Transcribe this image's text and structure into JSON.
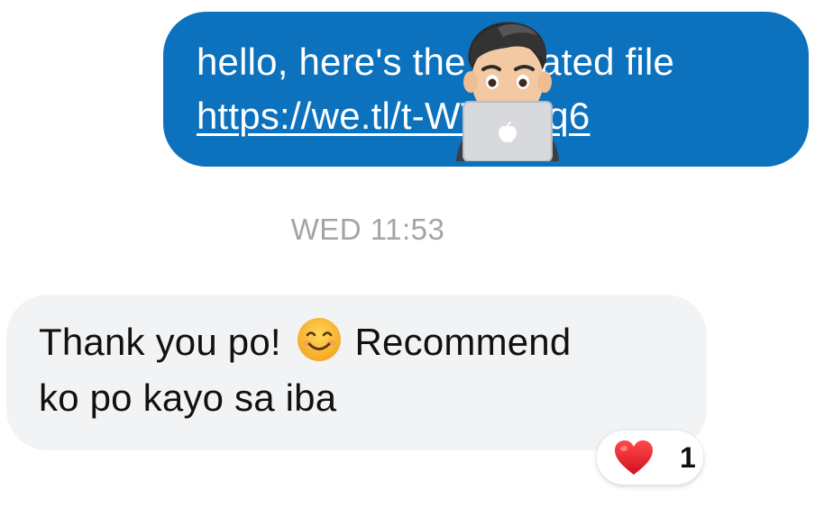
{
  "outgoing_message": {
    "line1": "hello, here's the updated file",
    "link": "https://we.tl/t-WTaHsq6",
    "bubble_color": "#0c72be"
  },
  "timestamp": "WED 11:53",
  "incoming_message": {
    "line1_before_emoji": "Thank you po!",
    "line1_after_emoji": "Recommend",
    "line2": "ko po kayo sa iba",
    "emoji": "smiling-face-emoji",
    "bubble_color": "#f1f3f5"
  },
  "reaction": {
    "icon": "red-heart",
    "count": "1"
  },
  "sticker": {
    "icon": "memoji-laptop"
  }
}
